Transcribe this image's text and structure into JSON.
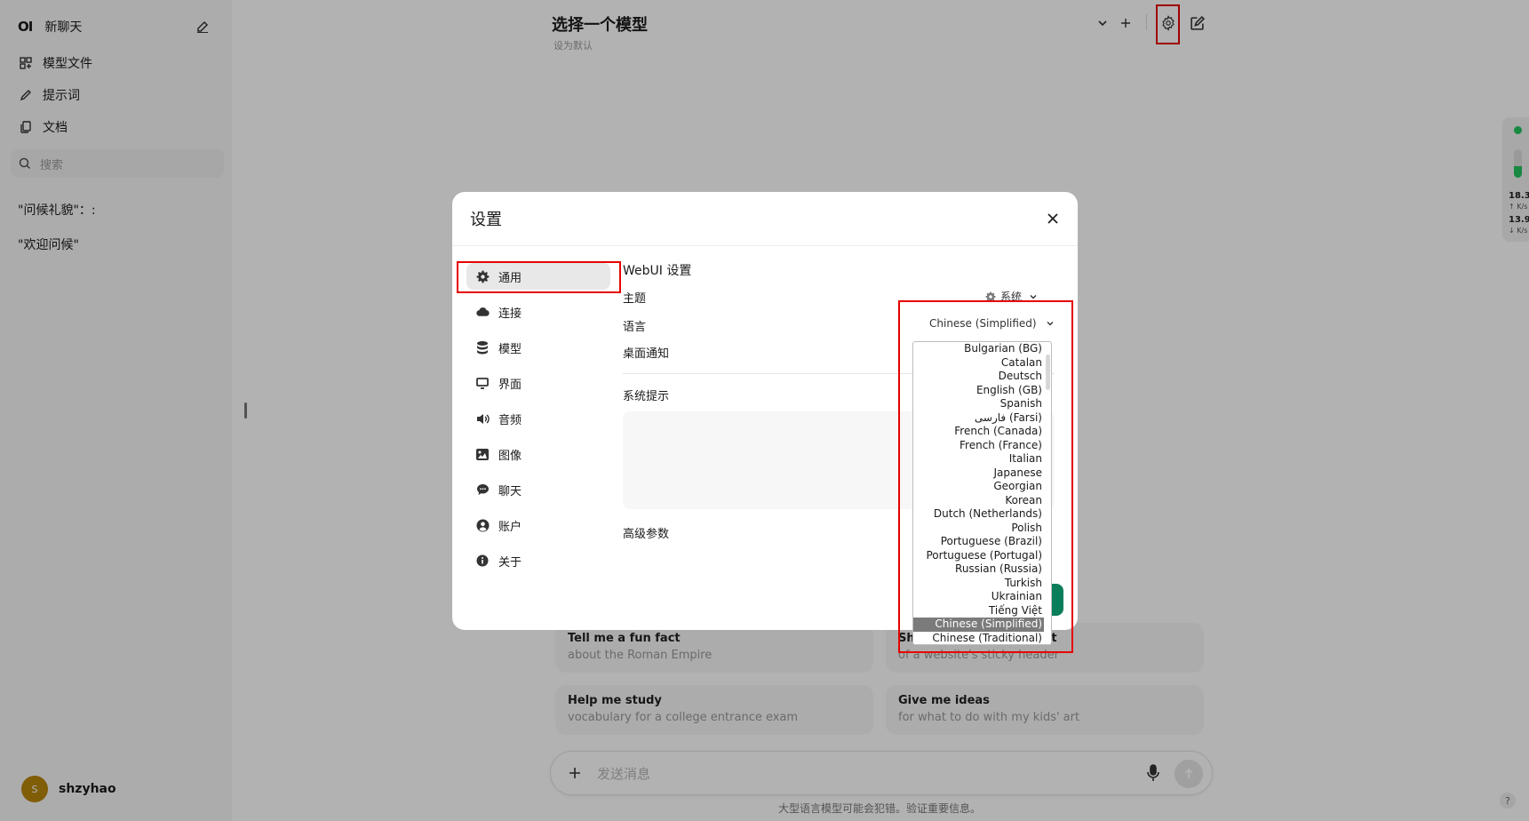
{
  "sidebar": {
    "logo": "OI",
    "new_chat": "新聊天",
    "nav": [
      {
        "label": "模型文件",
        "icon": "cubes-icon"
      },
      {
        "label": "提示词",
        "icon": "pencil-icon"
      },
      {
        "label": "文档",
        "icon": "documents-icon"
      }
    ],
    "search_placeholder": "搜索",
    "chats": [
      "\"问候礼貌\"：:",
      "\"欢迎问候\""
    ],
    "user": {
      "initial": "S",
      "name": "shzyhao"
    }
  },
  "header": {
    "title": "选择一个模型",
    "subtitle": "设为默认"
  },
  "suggestions": [
    {
      "title": "Tell me a fun fact",
      "subtitle": "about the Roman Empire"
    },
    {
      "title": "Show me a code snippet",
      "subtitle": "of a website's sticky header"
    },
    {
      "title": "Help me study",
      "subtitle": "vocabulary for a college entrance exam"
    },
    {
      "title": "Give me ideas",
      "subtitle": "for what to do with my kids' art"
    }
  ],
  "composer": {
    "placeholder": "发送消息",
    "disclaimer": "大型语言模型可能会犯错。验证重要信息。"
  },
  "help_label": "?",
  "network": {
    "upload": "18.3",
    "upload_unit": "↑ K/s",
    "download": "13.9",
    "download_unit": "↓ K/s"
  },
  "settings": {
    "title": "设置",
    "tabs": [
      {
        "label": "通用",
        "icon": "gear-icon",
        "active": true
      },
      {
        "label": "连接",
        "icon": "cloud-icon"
      },
      {
        "label": "模型",
        "icon": "database-icon"
      },
      {
        "label": "界面",
        "icon": "monitor-icon"
      },
      {
        "label": "音频",
        "icon": "speaker-icon"
      },
      {
        "label": "图像",
        "icon": "image-icon"
      },
      {
        "label": "聊天",
        "icon": "chat-bubble-icon"
      },
      {
        "label": "账户",
        "icon": "user-circle-icon"
      },
      {
        "label": "关于",
        "icon": "info-icon"
      }
    ],
    "webui_heading": "WebUI 设置",
    "theme_label": "主题",
    "theme_value": "系统",
    "language_label": "语言",
    "language_value": "Chinese (Simplified)",
    "notification_label": "桌面通知",
    "system_prompt_heading": "系统提示",
    "advanced_heading": "高级参数"
  },
  "language_options": [
    "Bulgarian (BG)",
    "Catalan",
    "Deutsch",
    "English (GB)",
    "Spanish",
    "فارسی (Farsi)",
    "French (Canada)",
    "French (France)",
    "Italian",
    "Japanese",
    "Georgian",
    "Korean",
    "Dutch (Netherlands)",
    "Polish",
    "Portuguese (Brazil)",
    "Portuguese (Portugal)",
    "Russian (Russia)",
    "Turkish",
    "Ukrainian",
    "Tiếng Việt",
    "Chinese (Simplified)",
    "Chinese (Traditional)"
  ],
  "selected_language_index": 20,
  "colors": {
    "annotation_red": "#e60000",
    "accent_green": "#0a7d5a",
    "status_green": "#22c55e"
  }
}
